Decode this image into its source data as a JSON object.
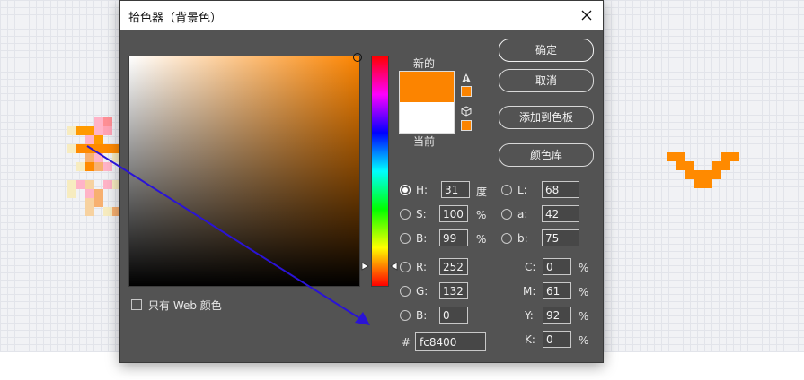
{
  "dialog": {
    "title": "拾色器（背景色）"
  },
  "colors": {
    "selected": "#fc8400",
    "current": "#ffffff",
    "pixel_art_primary": "#ff8a00",
    "arrow": "#2a13d6"
  },
  "swatch": {
    "new_label": "新的",
    "current_label": "当前"
  },
  "buttons": {
    "ok": "确定",
    "cancel": "取消",
    "add_to_swatches": "添加到色板",
    "color_libraries": "颜色库"
  },
  "hsb": {
    "h_label": "H:",
    "h_value": "31",
    "h_unit": "度",
    "s_label": "S:",
    "s_value": "100",
    "s_unit": "%",
    "b_label": "B:",
    "b_value": "99",
    "b_unit": "%"
  },
  "rgb": {
    "r_label": "R:",
    "r_value": "252",
    "g_label": "G:",
    "g_value": "132",
    "b_label": "B:",
    "b_value": "0"
  },
  "lab": {
    "l_label": "L:",
    "l_value": "68",
    "a_label": "a:",
    "a_value": "42",
    "b_label": "b:",
    "b_value": "75"
  },
  "cmyk": {
    "c_label": "C:",
    "c_value": "0",
    "m_label": "M:",
    "m_value": "61",
    "y_label": "Y:",
    "y_value": "92",
    "k_label": "K:",
    "k_value": "0",
    "unit": "%"
  },
  "hex": {
    "label": "#",
    "value": "fc8400"
  },
  "web_only": {
    "label": "只有 Web 颜色",
    "checked": false
  },
  "icons": {
    "close": "close-icon",
    "gamut_warning": "warning-triangle-icon",
    "web_safe": "cube-icon"
  }
}
